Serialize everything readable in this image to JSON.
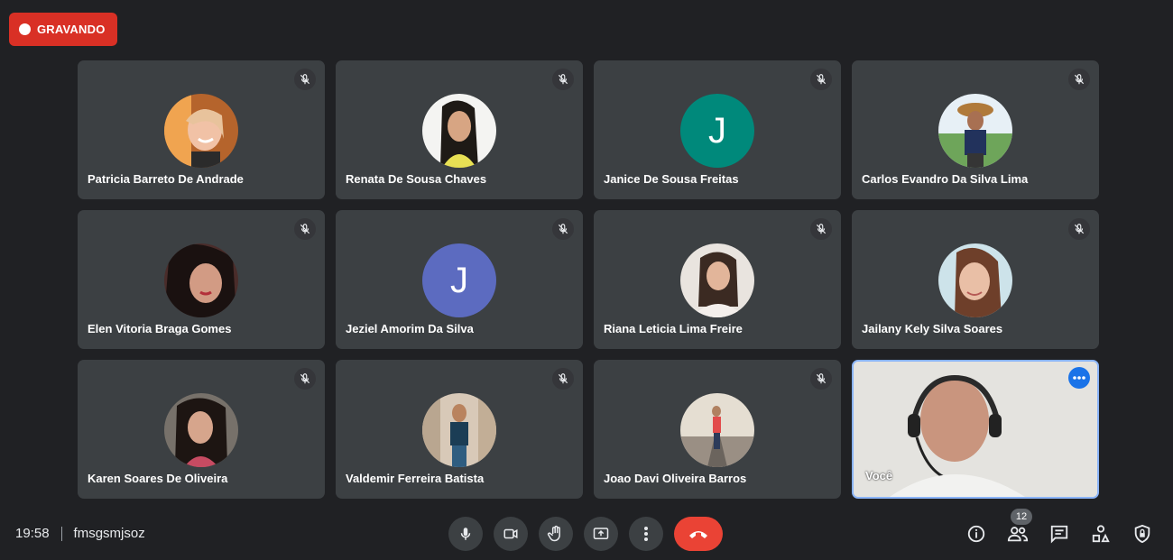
{
  "recording": {
    "label": "GRAVANDO"
  },
  "participants": [
    {
      "name": "Patricia Barreto De Andrade",
      "avatar": "photo"
    },
    {
      "name": "Renata De Sousa Chaves",
      "avatar": "photo"
    },
    {
      "name": "Janice De Sousa Freitas",
      "avatar": "letter",
      "letter": "J",
      "color": "#00897b"
    },
    {
      "name": "Carlos Evandro Da Silva Lima",
      "avatar": "photo"
    },
    {
      "name": "Elen Vitoria Braga Gomes",
      "avatar": "photo"
    },
    {
      "name": "Jeziel Amorim Da Silva",
      "avatar": "letter",
      "letter": "J",
      "color": "#5c6bc0"
    },
    {
      "name": "Riana Leticia Lima Freire",
      "avatar": "photo"
    },
    {
      "name": "Jailany Kely Silva Soares",
      "avatar": "photo"
    },
    {
      "name": "Karen Soares De Oliveira",
      "avatar": "photo"
    },
    {
      "name": "Valdemir Ferreira Batista",
      "avatar": "photo"
    },
    {
      "name": "Joao Davi Oliveira Barros",
      "avatar": "photo"
    }
  ],
  "self": {
    "label": "Você"
  },
  "footer": {
    "time": "19:58",
    "meeting_code": "fmsgsmjsoz",
    "participants_count": "12"
  },
  "colors": {
    "background": "#202124",
    "tile": "#3c4043",
    "record": "#d93025",
    "hangup": "#ea4335",
    "accent": "#8ab4f8"
  },
  "icons": [
    "mic-off-icon",
    "more-options-icon",
    "mic-icon",
    "camera-icon",
    "raise-hand-icon",
    "present-icon",
    "more-vert-icon",
    "hang-up-icon",
    "info-icon",
    "people-icon",
    "chat-icon",
    "activities-icon",
    "host-controls-icon"
  ]
}
